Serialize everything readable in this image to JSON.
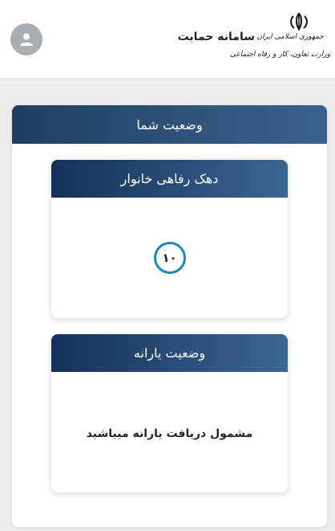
{
  "header": {
    "app_title": "سامانه حمایت",
    "logo": {
      "line1": "جمهوری اسلامی ایران",
      "line2": "وزارت تعاون، کار و رفاه اجتماعی",
      "emblem_icon": "iran-emblem-icon"
    },
    "avatar_icon": "user-icon"
  },
  "status_card": {
    "title": "وضعیت شما",
    "decile": {
      "title": "دهک رفاهی خانوار",
      "value": "۱۰",
      "circle_color": "#1a87c0"
    },
    "subsidy": {
      "title": "وضعیت یارانه",
      "message": "مشمول دریافت یارانه میباشید"
    }
  },
  "colors": {
    "header_bar": "#2e5480",
    "inner_header": "#1f4068",
    "page_background": "#ececec"
  }
}
